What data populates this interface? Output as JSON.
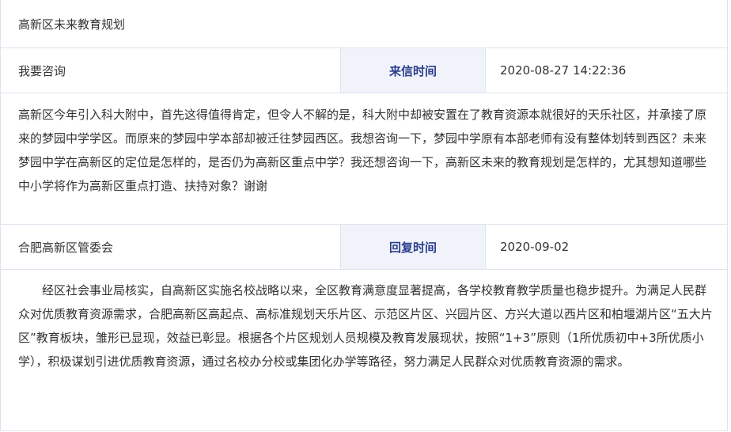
{
  "title": "高新区未来教育规划",
  "question": {
    "from": "我要咨询",
    "time_label": "来信时间",
    "time_value": "2020-08-27 14:22:36",
    "text": "高新区今年引入科大附中，首先这得值得肯定，但令人不解的是，科大附中却被安置在了教育资源本就很好的天乐社区，并承接了原来的梦园中学学区。而原来的梦园中学本部却被迁往梦园西区。我想咨询一下，梦园中学原有本部老师有没有整体划转到西区？未来梦园中学在高新区的定位是怎样的，是否仍为高新区重点中学？我还想咨询一下，高新区未来的教育规划是怎样的，尤其想知道哪些中小学将作为高新区重点打造、扶持对象？谢谢"
  },
  "reply": {
    "from": "合肥高新区管委会",
    "time_label": "回复时间",
    "time_value": "2020-09-02",
    "text": "经区社会事业局核实，自高新区实施名校战略以来，全区教育满意度显著提高，各学校教育教学质量也稳步提升。为满足人民群众对优质教育资源需求，合肥高新区高起点、高标准规划天乐片区、示范区片区、兴园片区、方兴大道以西片区和柏堰湖片区“五大片区”教育板块，雏形已显现，效益已彰显。根据各个片区规划人员规模及教育发展现状，按照“1+3”原则（1所优质初中+3所优质小学），积极谋划引进优质教育资源，通过名校办分校或集团化办学等路径，努力满足人民群众对优质教育资源的需求。"
  }
}
